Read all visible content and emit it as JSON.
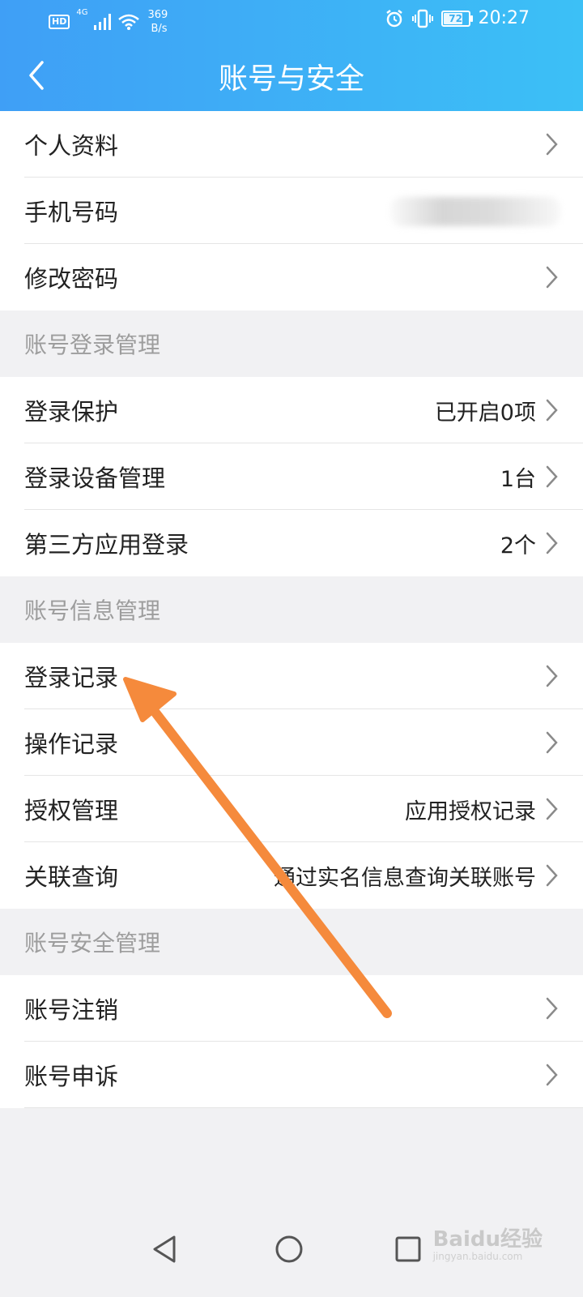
{
  "status_bar": {
    "hd": "HD",
    "network": "4G",
    "speed_value": "369",
    "speed_unit": "B/s",
    "battery": "72",
    "time": "20:27"
  },
  "header": {
    "title": "账号与安全"
  },
  "rows": {
    "personal_info": {
      "label": "个人资料"
    },
    "phone": {
      "label": "手机号码"
    },
    "change_password": {
      "label": "修改密码"
    },
    "login_protection": {
      "label": "登录保护",
      "value": "已开启0项"
    },
    "device_management": {
      "label": "登录设备管理",
      "value": "1台"
    },
    "third_party_login": {
      "label": "第三方应用登录",
      "value": "2个"
    },
    "login_records": {
      "label": "登录记录"
    },
    "operation_records": {
      "label": "操作记录"
    },
    "authorization": {
      "label": "授权管理",
      "value": "应用授权记录"
    },
    "association_query": {
      "label": "关联查询",
      "value": "通过实名信息查询关联账号"
    },
    "account_cancel": {
      "label": "账号注销"
    },
    "account_appeal": {
      "label": "账号申诉"
    }
  },
  "sections": {
    "login_management": "账号登录管理",
    "info_management": "账号信息管理",
    "security_management": "账号安全管理"
  },
  "watermark": {
    "brand": "Baidu经验",
    "url": "jingyan.baidu.com"
  },
  "colors": {
    "header_start": "#3f9ff6",
    "header_end": "#3cc0f6",
    "annotation_arrow": "#f58a3c"
  }
}
